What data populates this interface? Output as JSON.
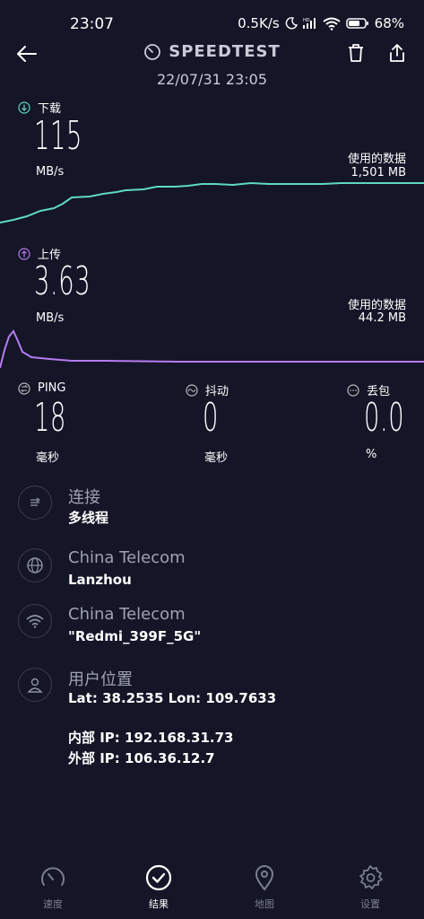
{
  "status_bar": {
    "time": "23:07",
    "speed": "0.5K/s",
    "battery": "68%",
    "icons": [
      "moon-icon",
      "hd-icon",
      "signal-icon",
      "wifi-icon",
      "battery-icon"
    ]
  },
  "header": {
    "title": "SPEEDTEST",
    "date": "22/07/31 23:05"
  },
  "download": {
    "label": "下载",
    "value": "115",
    "unit": "MB/s",
    "data_used_label": "使用的数据",
    "data_used_value": "1,501 MB",
    "color": "#5fd9c4"
  },
  "upload": {
    "label": "上传",
    "value": "3.63",
    "unit": "MB/s",
    "data_used_label": "使用的数据",
    "data_used_value": "44.2 MB",
    "color": "#b57cf0"
  },
  "stats": {
    "ping": {
      "label": "PING",
      "value": "18",
      "unit": "毫秒"
    },
    "jitter": {
      "label": "抖动",
      "value": "0",
      "unit": "毫秒"
    },
    "loss": {
      "label": "丢包",
      "value": "0.0",
      "unit": "%"
    }
  },
  "info": {
    "connection": {
      "title": "连接",
      "sub": "多线程"
    },
    "isp": {
      "title": "China Telecom",
      "sub": "Lanzhou"
    },
    "wifi": {
      "title": "China Telecom",
      "sub": "\"Redmi_399F_5G\""
    },
    "location": {
      "title": "用户位置",
      "sub": "Lat: 38.2535 Lon: 109.7633"
    },
    "internal_ip": "内部 IP: 192.168.31.73",
    "external_ip": "外部 IP: 106.36.12.7"
  },
  "nav": {
    "items": [
      {
        "label": "速度",
        "icon": "speedometer-icon",
        "active": false
      },
      {
        "label": "结果",
        "icon": "check-circle-icon",
        "active": true
      },
      {
        "label": "地图",
        "icon": "map-pin-icon",
        "active": false
      },
      {
        "label": "设置",
        "icon": "gear-icon",
        "active": false
      }
    ]
  },
  "colors": {
    "background": "#141527",
    "download_accent": "#5fd9c4",
    "upload_accent": "#b57cf0",
    "muted_text": "#9fa2b4"
  }
}
